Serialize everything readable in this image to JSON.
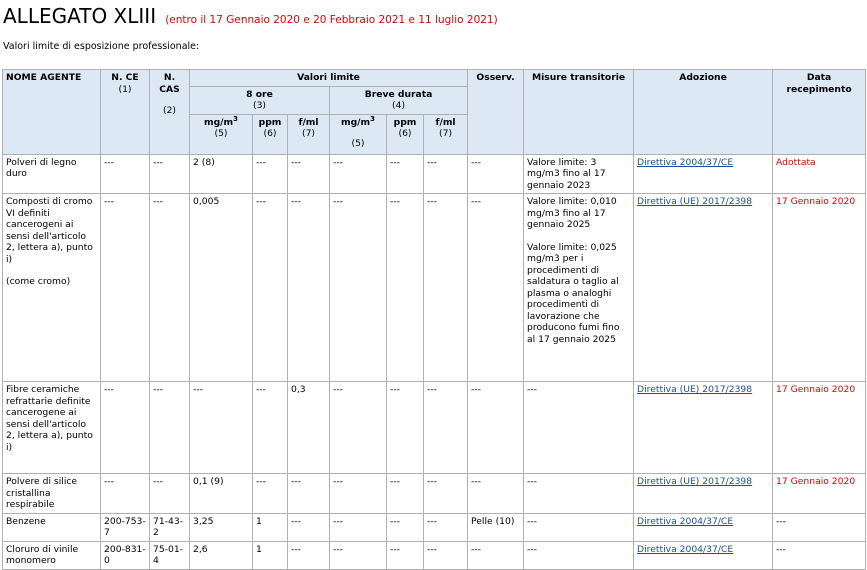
{
  "title": {
    "main": "ALLEGATO XLIII",
    "sub": "(entro il 17 Gennaio 2020 e 20 Febbraio 2021 e 11 luglio 2021)"
  },
  "intro": "Valori limite di esposizione professionale:",
  "headers": {
    "agent": "NOME AGENTE",
    "ce": "N. CE",
    "ce_note": "(1)",
    "cas": "N. CAS",
    "cas_note": "(2)",
    "limits": "Valori limite",
    "eight": "8 ore",
    "eight_note": "(3)",
    "short": "Breve durata",
    "short_note": "(4)",
    "mg": "mg/m",
    "mg_sup": "3",
    "mg_note": "(5)",
    "ppm": "ppm",
    "ppm_note": "(6)",
    "fml": "f/ml",
    "fml_note": "(7)",
    "obs": "Osserv.",
    "trans": "Misure transitorie",
    "adoption": "Adozione",
    "date": "Data recepimento"
  },
  "rows": [
    {
      "agent": "Polveri di legno duro",
      "ce": "---",
      "cas": "---",
      "mg8": "2 (8)",
      "ppm8": "---",
      "fml8": "---",
      "mgs": "---",
      "ppms": "---",
      "fmls": "---",
      "obs": "---",
      "trans": [
        "Valore limite: 3 mg/m3 fino al 17 gennaio 2023"
      ],
      "adoption": "Direttiva 2004/37/CE",
      "date": "Adottata"
    },
    {
      "agent": "Composti di cromo VI definiti cancerogeni ai sensi dell'articolo 2, lettera a), punto i)",
      "agent_extra": "(come cromo)",
      "ce": "---",
      "cas": "---",
      "mg8": "0,005",
      "ppm8": "---",
      "fml8": "---",
      "mgs": "---",
      "ppms": "---",
      "fmls": "---",
      "obs": "---",
      "trans": [
        "Valore limite: 0,010 mg/m3 fino al 17 gennaio 2025",
        "Valore limite: 0,025 mg/m3 per i procedimenti di saldatura o taglio al plasma o analoghi procedimenti di lavorazione che producono fumi fino al 17 gennaio 2025"
      ],
      "adoption": "Direttiva (UE) 2017/2398",
      "date": "17 Gennaio 2020"
    },
    {
      "agent": "Fibre ceramiche refrattarie definite cancerogene ai sensi dell'articolo 2, lettera a), punto i)",
      "ce": "---",
      "cas": "---",
      "mg8": "---",
      "ppm8": "---",
      "fml8": "0,3",
      "mgs": "---",
      "ppms": "---",
      "fmls": "---",
      "obs": "---",
      "trans": [
        "---"
      ],
      "adoption": "Direttiva (UE) 2017/2398",
      "date": "17 Gennaio 2020"
    },
    {
      "agent": "Polvere di silice cristallina respirabile",
      "ce": "---",
      "cas": "---",
      "mg8": "0,1 (9)",
      "ppm8": "---",
      "fml8": "---",
      "mgs": "---",
      "ppms": "---",
      "fmls": "---",
      "obs": "---",
      "trans": [
        "---"
      ],
      "adoption": "Direttiva (UE) 2017/2398",
      "date": "17 Gennaio 2020"
    },
    {
      "agent": "Benzene",
      "ce": "200-753-7",
      "cas": "71-43-2",
      "mg8": "3,25",
      "ppm8": "1",
      "fml8": "---",
      "mgs": "---",
      "ppms": "---",
      "fmls": "---",
      "obs": "Pelle (10)",
      "trans": [
        "---"
      ],
      "adoption": "Direttiva 2004/37/CE",
      "date": "---"
    },
    {
      "agent": "Cloruro di vinile monomero",
      "ce": "200-831-0",
      "cas": "75-01-4",
      "mg8": "2,6",
      "ppm8": "1",
      "fml8": "---",
      "mgs": "---",
      "ppms": "---",
      "fmls": "---",
      "obs": "---",
      "trans": [
        "---"
      ],
      "adoption": "Direttiva 2004/37/CE",
      "date": "---"
    }
  ],
  "colors": {
    "accent_red": "#e00000",
    "link": "#1a4fa0",
    "header_bg": "#dce9f5"
  }
}
